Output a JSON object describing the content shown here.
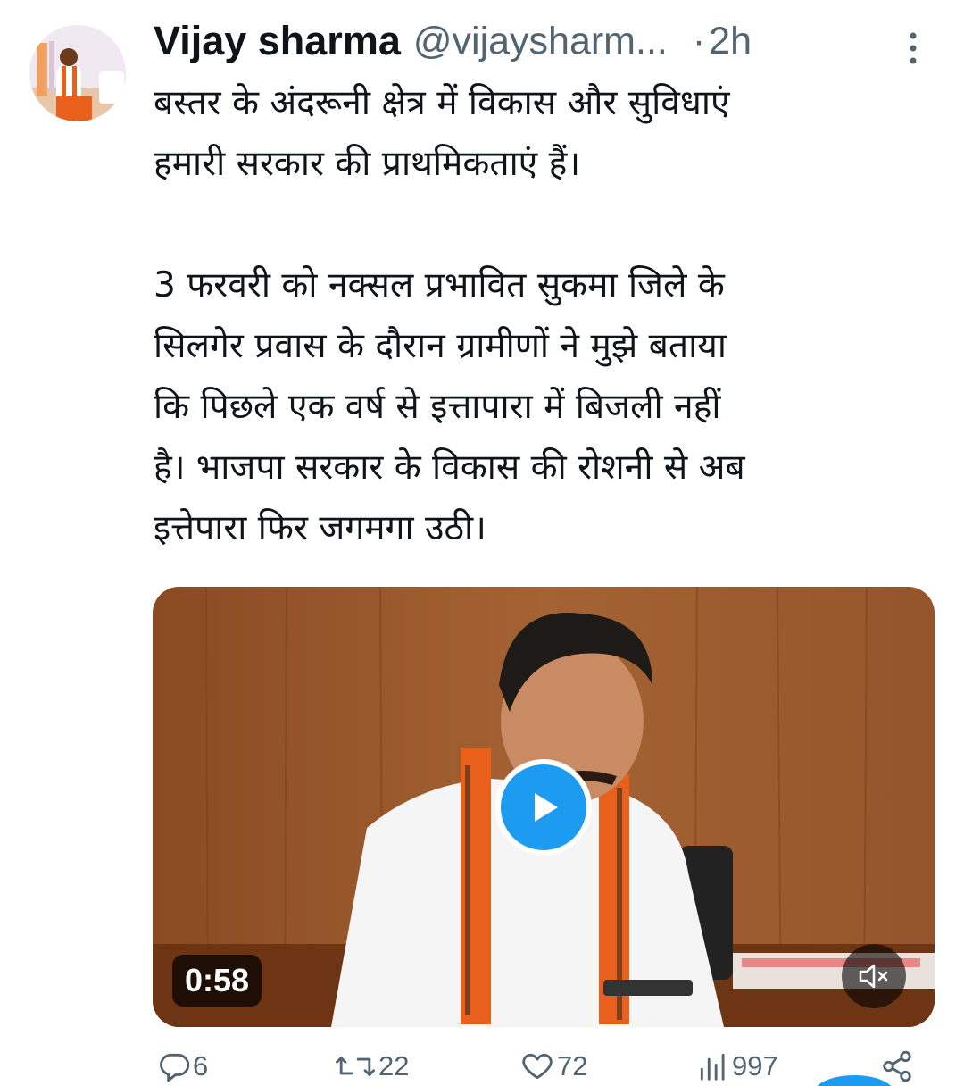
{
  "author": {
    "name": "Vijay sharma",
    "handle": "@vijaysharm...",
    "separator": "·",
    "time": "2h",
    "avatar_icon": "profile-photo"
  },
  "tweet": {
    "text": "बस्तर के अंदरूनी क्षेत्र में विकास और सुविधाएं\nहमारी सरकार की प्राथमिकताएं हैं।\n\n3 फरवरी को नक्सल प्रभावित सुकमा जिले के\nसिलगेर प्रवास के दौरान ग्रामीणों ने मुझे बताया\nकि पिछले एक वर्ष से इत्तापारा में बिजली नहीं\nहै। भाजपा सरकार के विकास की रोशनी  से अब\nइत्तेपारा फिर जगमगा उठी।"
  },
  "video": {
    "duration": "0:58",
    "play_icon": "play-icon",
    "mute_icon": "speaker-muted-icon"
  },
  "actions": {
    "replies": "6",
    "retweets": "22",
    "likes": "72",
    "views": "997"
  },
  "colors": {
    "accent": "#1d9bf0",
    "text": "#0f1419",
    "secondary": "#536471"
  }
}
